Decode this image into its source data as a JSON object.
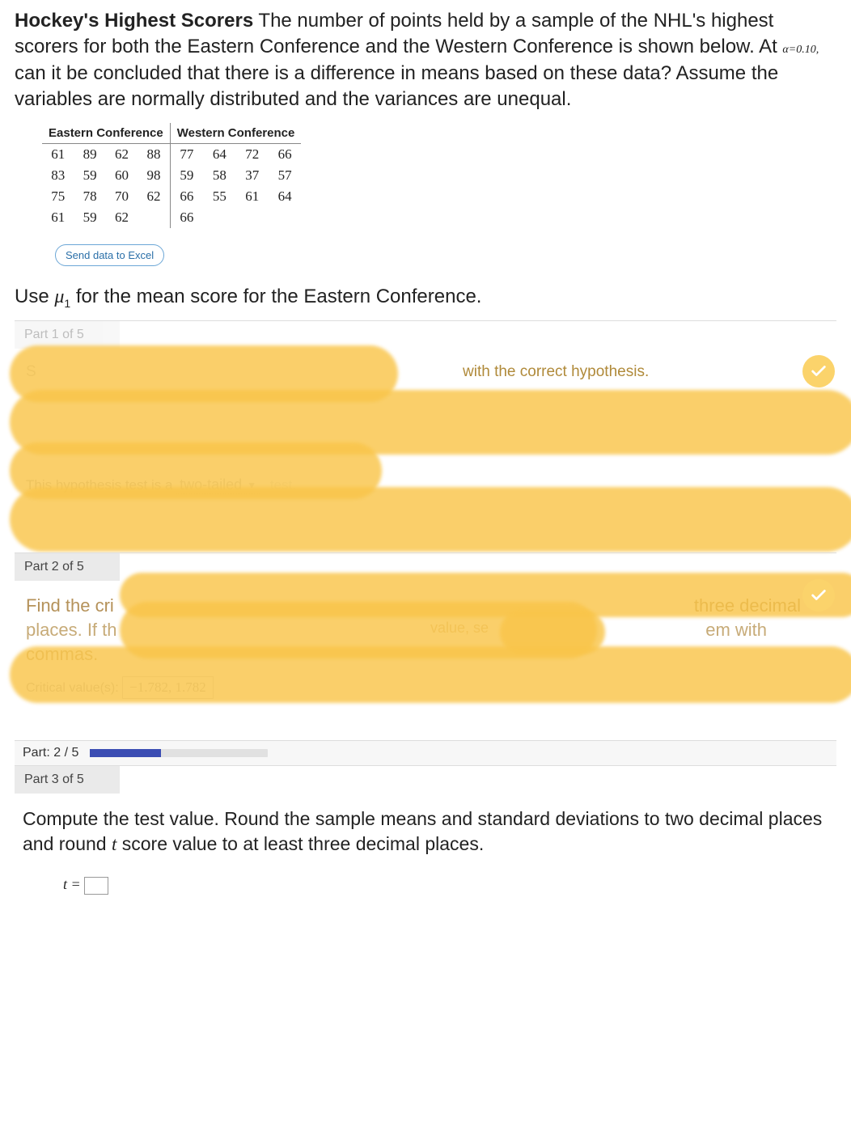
{
  "prompt": {
    "title": "Hockey's Highest Scorers",
    "body_before_alpha": " The number of points held by a sample of the NHL's highest scorers for both the Eastern Conference and the Western Conference is shown below. At ",
    "alpha_expr": "α=0.10,",
    "body_after_alpha": " can it be concluded that there is a difference in means based on these data? Assume the variables are normally distributed and the variances are unequal."
  },
  "table": {
    "headers": {
      "east": "Eastern Conference",
      "west": "Western Conference"
    },
    "rows": [
      {
        "east": [
          "61",
          "89",
          "62",
          "88"
        ],
        "west": [
          "77",
          "64",
          "72",
          "66"
        ]
      },
      {
        "east": [
          "83",
          "59",
          "60",
          "98"
        ],
        "west": [
          "59",
          "58",
          "37",
          "57"
        ]
      },
      {
        "east": [
          "75",
          "78",
          "70",
          "62"
        ],
        "west": [
          "66",
          "55",
          "61",
          "64"
        ]
      },
      {
        "east": [
          "61",
          "59",
          "62",
          ""
        ],
        "west": [
          "66",
          "",
          "",
          ""
        ]
      }
    ]
  },
  "buttons": {
    "send_excel": "Send data to Excel"
  },
  "use_line": {
    "pre": "Use ",
    "mu": "μ",
    "sub": "1",
    "post": " for the mean score for the Eastern Conference."
  },
  "part1": {
    "header": "Part 1 of 5",
    "visible_text_right": "with the correct hypothesis.",
    "visible_text_left_prefix": "S",
    "two_tailed_line_pre": "This hypothesis test is a ",
    "two_tailed_value": "two-tailed",
    "two_tailed_suffix": "test."
  },
  "part2": {
    "header": "Part 2 of 5",
    "line1_left": "Find the cri",
    "line1_right": "three decimal",
    "line2_left": "places. If th",
    "line2_mid": "value, se",
    "line2_right": "em with",
    "line3": "commas.",
    "cv_label": "Critical value(s):",
    "cv_value": "−1.782, 1.782"
  },
  "progress": {
    "label": "Part: 2 / 5",
    "percent": 40
  },
  "part3": {
    "header": "Part 3 of 5",
    "body_pre": "Compute the test value. Round the sample means and standard deviations to two decimal places and round ",
    "t_italic": "t",
    "body_post": " score value to at least three decimal places.",
    "t_equals": "t ="
  },
  "colors": {
    "highlight": "#f9c54a"
  }
}
